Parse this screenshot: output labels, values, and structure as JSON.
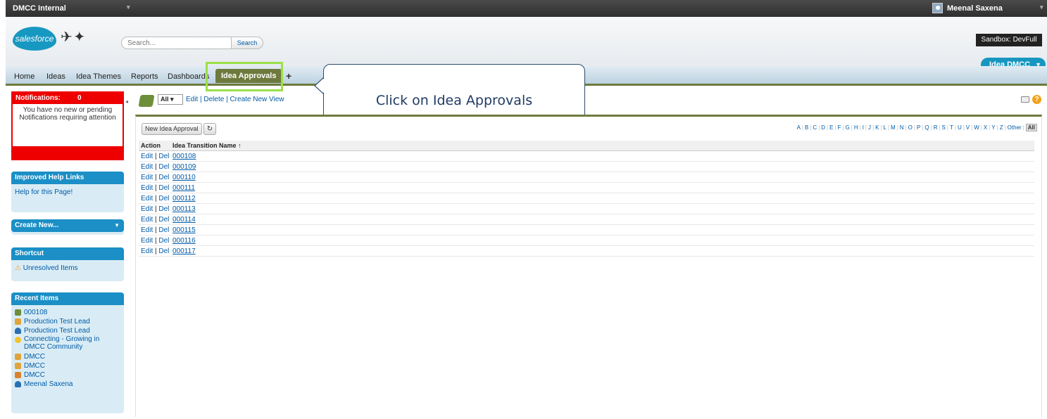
{
  "topbar": {
    "org_name": "DMCC Internal",
    "user_name": "Meenal Saxena"
  },
  "header": {
    "logo_text": "salesforce",
    "search_placeholder": "Search...",
    "search_button": "Search",
    "sandbox_label": "Sandbox:  DevFull",
    "app_menu": "Idea DMCC"
  },
  "tabs": [
    {
      "label": "Home"
    },
    {
      "label": "Ideas"
    },
    {
      "label": "Idea Themes"
    },
    {
      "label": "Reports"
    },
    {
      "label": "Dashboards"
    },
    {
      "label": "Idea Approvals",
      "active": true
    }
  ],
  "tab_add": "+",
  "callout": {
    "text": "Click on Idea Approvals"
  },
  "sidebar": {
    "notifications": {
      "title": "Notifications:",
      "count": "0",
      "message": "You have no new or pending Notifications requiring attention"
    },
    "help_links": {
      "title": "Improved Help Links",
      "link": "Help for this Page!"
    },
    "create_new": {
      "title": "Create New..."
    },
    "shortcut": {
      "title": "Shortcut",
      "item": "Unresolved Items"
    },
    "recent": {
      "title": "Recent Items",
      "items": [
        "000108",
        "Production Test Lead",
        "Production Test Lead",
        "Connecting - Growing in DMCC Community",
        "DMCC",
        "DMCC",
        "DMCC",
        "Meenal Saxena"
      ]
    }
  },
  "main": {
    "view_select": "All",
    "view_links": {
      "edit": "Edit",
      "delete": "Delete",
      "create": "Create New View"
    },
    "new_button": "New Idea Approval",
    "alphabet": [
      "A",
      "B",
      "C",
      "D",
      "E",
      "F",
      "G",
      "H",
      "I",
      "J",
      "K",
      "L",
      "M",
      "N",
      "O",
      "P",
      "Q",
      "R",
      "S",
      "T",
      "U",
      "V",
      "W",
      "X",
      "Y",
      "Z",
      "Other",
      "All"
    ],
    "table": {
      "headers": {
        "action": "Action",
        "name": "Idea Transition Name ↑"
      },
      "edit_label": "Edit",
      "del_label": "Del",
      "rows": [
        "000108",
        "000109",
        "000110",
        "000111",
        "000112",
        "000113",
        "000114",
        "000115",
        "000116",
        "000117"
      ]
    }
  }
}
